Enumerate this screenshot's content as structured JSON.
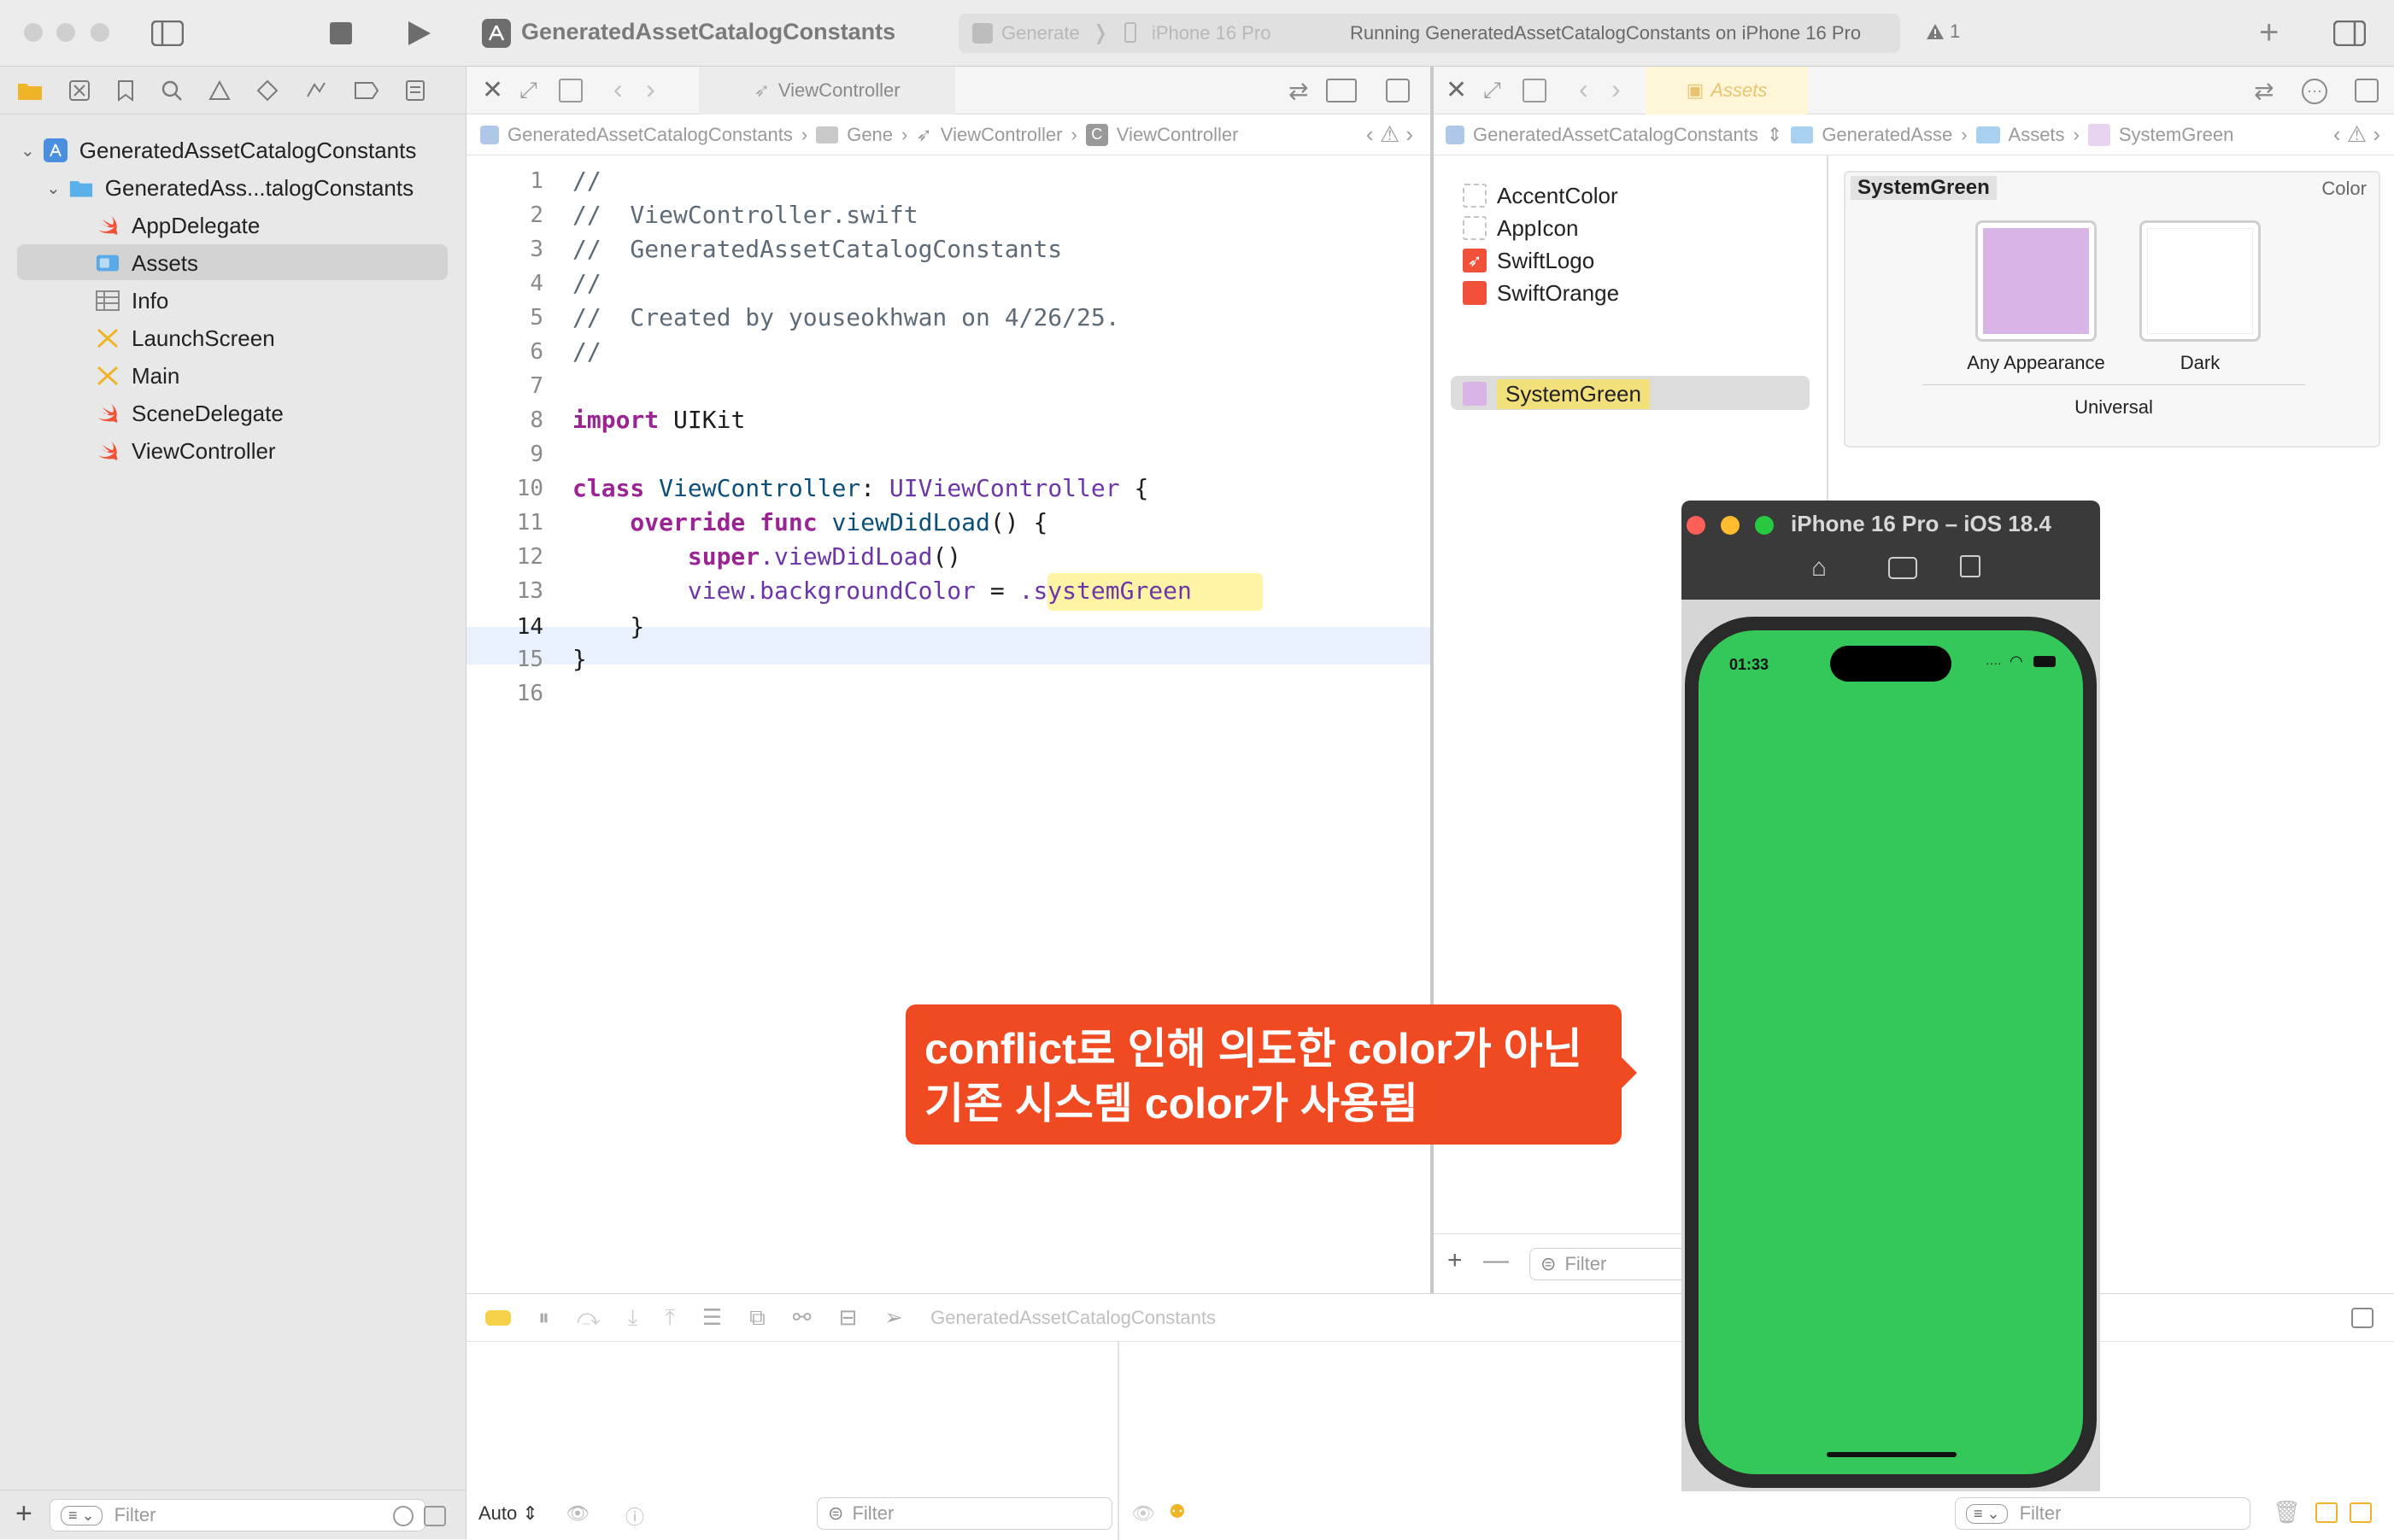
{
  "toolbar": {
    "project_title": "GeneratedAssetCatalogConstants",
    "scheme": "Generate",
    "destination": "iPhone 16 Pro",
    "status": "Running GeneratedAssetCatalogConstants on iPhone 16 Pro",
    "warning_count": "1"
  },
  "navigator": {
    "project": "GeneratedAssetCatalogConstants",
    "group": "GeneratedAss...talogConstants",
    "files": [
      {
        "label": "AppDelegate",
        "icon": "swift-file-icon"
      },
      {
        "label": "Assets",
        "icon": "asset-catalog-icon"
      },
      {
        "label": "Info",
        "icon": "plist-icon"
      },
      {
        "label": "LaunchScreen",
        "icon": "storyboard-icon"
      },
      {
        "label": "Main",
        "icon": "storyboard-icon"
      },
      {
        "label": "SceneDelegate",
        "icon": "swift-file-icon"
      },
      {
        "label": "ViewController",
        "icon": "swift-file-icon"
      }
    ],
    "filter_placeholder": "Filter"
  },
  "editor": {
    "tab": "ViewController",
    "jumpbar": [
      "GeneratedAssetCatalogConstants",
      "Gene",
      "ViewController",
      "ViewController"
    ],
    "lines": [
      "1",
      "2",
      "3",
      "4",
      "5",
      "6",
      "7",
      "8",
      "9",
      "10",
      "11",
      "12",
      "13",
      "14",
      "15",
      "16"
    ],
    "code": {
      "l1": "//",
      "l2": "//  ViewController.swift",
      "l3": "//  GeneratedAssetCatalogConstants",
      "l4": "//",
      "l5": "//  Created by youseokhwan on 4/26/25.",
      "l6": "//",
      "l8a": "import",
      "l8b": " UIKit",
      "l10a": "class",
      "l10b": " ViewController",
      "l10c": ": ",
      "l10d": "UIViewController",
      "l10e": " {",
      "l11a": "    override",
      "l11b": " func",
      "l11c": " viewDidLoad",
      "l11d": "() {",
      "l12a": "        super",
      "l12b": ".viewDidLoad",
      "l12c": "()",
      "l13a": "        view.backgroundColor",
      "l13b": " = ",
      "l13c": ".systemGreen",
      "l14": "    }",
      "l15": "}"
    }
  },
  "assets": {
    "tab": "Assets",
    "jumpbar": [
      "GeneratedAssetCatalogConstants",
      "GeneratedAsse",
      "Assets",
      "SystemGreen"
    ],
    "items": [
      {
        "label": "AccentColor",
        "color": ""
      },
      {
        "label": "AppIcon",
        "color": ""
      },
      {
        "label": "SwiftLogo",
        "color": "#f05138"
      },
      {
        "label": "SwiftOrange",
        "color": "#f05138"
      },
      {
        "label": "SystemGreen",
        "color": "#d9b4e6"
      }
    ],
    "selected_name": "SystemGreen",
    "kind": "Color",
    "any_appearance": "Any Appearance",
    "dark": "Dark",
    "universal": "Universal",
    "swatch_color": "#d9b4e6",
    "filter_placeholder": "Filter"
  },
  "debug": {
    "scheme": "GeneratedAssetCatalogConstants",
    "auto": "Auto",
    "filter_placeholder": "Filter"
  },
  "simulator": {
    "title": "iPhone 16 Pro – iOS 18.4",
    "time": "01:33",
    "screen_color": "#34c759"
  },
  "callout": {
    "line1": "conflict로 인해 의도한 color가 아닌",
    "line2": "기존 시스템 color가 사용됨"
  }
}
